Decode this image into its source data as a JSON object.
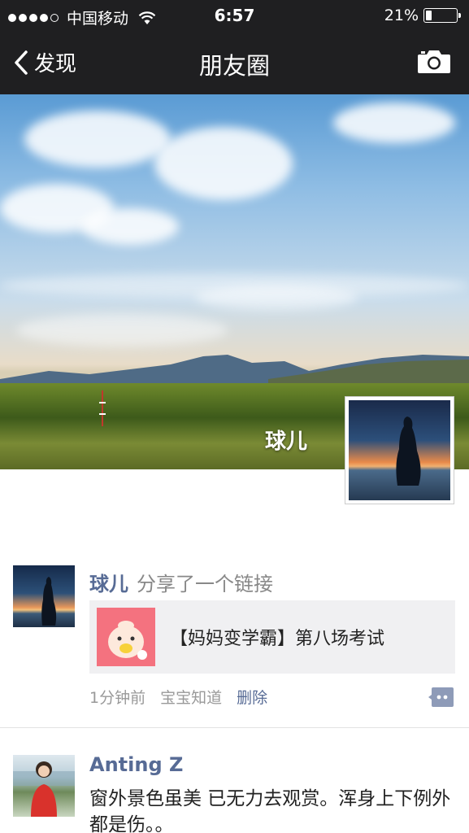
{
  "status": {
    "carrier": "中国移动",
    "time": "6:57",
    "battery": "21%",
    "battery_level": 0.21
  },
  "nav": {
    "back_label": "发现",
    "title": "朋友圈"
  },
  "cover": {
    "name": "球儿"
  },
  "posts": [
    {
      "author": "球儿",
      "action": "分享了一个链接",
      "link_title": "【妈妈变学霸】第八场考试",
      "time": "1分钟前",
      "source": "宝宝知道",
      "delete": "删除"
    },
    {
      "author": "Anting Z",
      "text": "窗外景色虽美 已无力去观赏。浑身上下例外都是伤。。"
    }
  ],
  "colors": {
    "bar": "#1f1f21",
    "link_blue": "#576b95",
    "card_bg": "#f0f0f2"
  }
}
